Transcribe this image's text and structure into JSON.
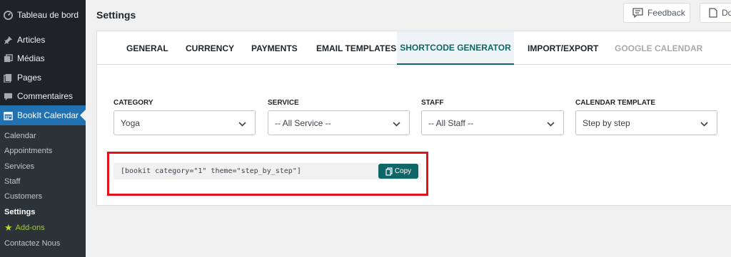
{
  "sidebar": {
    "menu": [
      {
        "label": "Tableau de bord",
        "icon": "dashboard-icon"
      },
      {
        "label": "Articles",
        "icon": "pushpin-icon"
      },
      {
        "label": "Médias",
        "icon": "media-icon"
      },
      {
        "label": "Pages",
        "icon": "pages-icon"
      },
      {
        "label": "Commentaires",
        "icon": "comments-icon"
      },
      {
        "label": "BookIt Calendar",
        "icon": "calendar-icon"
      }
    ],
    "submenu": [
      "Calendar",
      "Appointments",
      "Services",
      "Staff",
      "Customers",
      "Settings",
      "Add-ons",
      "Contactez Nous"
    ]
  },
  "header": {
    "title": "Settings",
    "feedback_label": "Feedback",
    "doc_label": "Do"
  },
  "tabs": [
    "GENERAL",
    "CURRENCY",
    "PAYMENTS",
    "EMAIL TEMPLATES",
    "SHORTCODE GENERATOR",
    "IMPORT/EXPORT",
    "GOOGLE CALENDAR"
  ],
  "active_tab": "SHORTCODE GENERATOR",
  "fields": {
    "category": {
      "label": "CATEGORY",
      "value": "Yoga"
    },
    "service": {
      "label": "SERVICE",
      "value": "-- All Service --"
    },
    "staff": {
      "label": "STAFF",
      "value": "-- All Staff --"
    },
    "template": {
      "label": "CALENDAR TEMPLATE",
      "value": "Step by step"
    }
  },
  "shortcode": {
    "text": "[bookit category=\"1\" theme=\"step_by_step\"]",
    "copy_label": "Copy"
  },
  "colors": {
    "sidebar_bg": "#1d2327",
    "active_menu": "#2271b1",
    "accent": "#0e6669",
    "highlight": "#e3131b",
    "addons": "#9ecb3f"
  }
}
